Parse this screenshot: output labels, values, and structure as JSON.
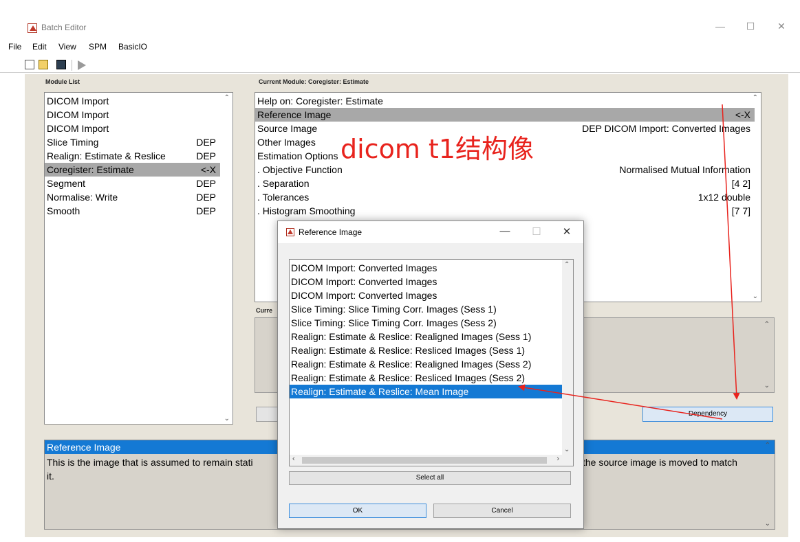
{
  "window": {
    "title": "Batch Editor",
    "minimize": "—",
    "maximize": "☐",
    "close": "✕"
  },
  "menu": [
    "File",
    "Edit",
    "View",
    "SPM",
    "BasicIO"
  ],
  "module_list": {
    "label": "Module List",
    "items": [
      {
        "name": "DICOM Import",
        "status": ""
      },
      {
        "name": "DICOM Import",
        "status": ""
      },
      {
        "name": "DICOM Import",
        "status": ""
      },
      {
        "name": "Slice Timing",
        "status": "DEP"
      },
      {
        "name": "Realign: Estimate & Reslice",
        "status": "DEP"
      },
      {
        "name": "Coregister: Estimate",
        "status": "<-X"
      },
      {
        "name": "Segment",
        "status": "DEP"
      },
      {
        "name": "Normalise: Write",
        "status": "DEP"
      },
      {
        "name": "Smooth",
        "status": "DEP"
      }
    ]
  },
  "current_module": {
    "label": "Current Module: Coregister: Estimate",
    "rows": [
      {
        "name": "Help on: Coregister: Estimate",
        "value": ""
      },
      {
        "name": "Reference Image",
        "value": "<-X"
      },
      {
        "name": "Source Image",
        "value": "DEP DICOM Import: Converted Images"
      },
      {
        "name": "Other Images",
        "value": ""
      },
      {
        "name": "Estimation Options",
        "value": ""
      },
      {
        "name": ". Objective Function",
        "value": "Normalised Mutual Information"
      },
      {
        "name": ". Separation",
        "value": "[4 2]"
      },
      {
        "name": ". Tolerances",
        "value": "1x12 double"
      },
      {
        "name": ". Histogram Smoothing",
        "value": "[7 7]"
      }
    ]
  },
  "current_item_label": "Curre",
  "dependency_button": "Dependency",
  "help": {
    "title": "Reference Image",
    "text_left": "This  is the image that is assumed to remain stati",
    "text_right": "the source image is moved to match",
    "text_line2": "it."
  },
  "annotation": "dicom t1结构像",
  "dialog": {
    "title": "Reference Image",
    "minimize": "—",
    "maximize": "☐",
    "close": "✕",
    "items": [
      "DICOM Import: Converted Images",
      "DICOM Import: Converted Images",
      "DICOM Import: Converted Images",
      "Slice Timing: Slice Timing Corr. Images (Sess 1)",
      "Slice Timing: Slice Timing Corr. Images (Sess 2)",
      "Realign: Estimate & Reslice: Realigned Images (Sess 1)",
      "Realign: Estimate & Reslice: Resliced Images (Sess 1)",
      "Realign: Estimate & Reslice: Realigned Images (Sess 2)",
      "Realign: Estimate & Reslice: Resliced Images (Sess 2)",
      "Realign: Estimate & Reslice: Mean Image"
    ],
    "selected_index": 9,
    "select_all": "Select all",
    "ok": "OK",
    "cancel": "Cancel"
  },
  "colors": {
    "selection_blue": "#1479d4",
    "selection_grey": "#a8a8a8",
    "annotation_red": "#e8231d",
    "panel_bg": "#e8e4da"
  }
}
